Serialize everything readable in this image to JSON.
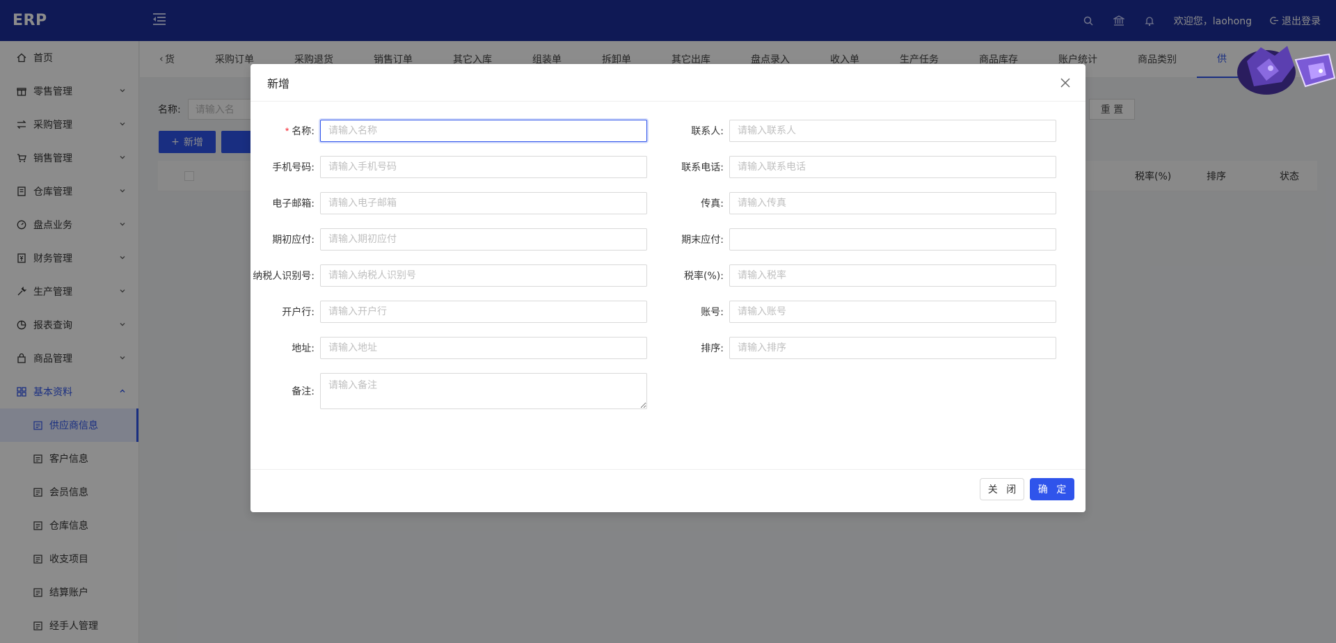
{
  "app": {
    "logo": "ERP"
  },
  "header": {
    "welcome": "欢迎您，laohong",
    "logout": "退出登录"
  },
  "sidebar": {
    "items": [
      {
        "label": "首页",
        "icon": "home-icon"
      },
      {
        "label": "零售管理",
        "icon": "gift-icon"
      },
      {
        "label": "采购管理",
        "icon": "swap-icon"
      },
      {
        "label": "销售管理",
        "icon": "cart-icon"
      },
      {
        "label": "仓库管理",
        "icon": "book-icon"
      },
      {
        "label": "盘点业务",
        "icon": "dashboard-icon"
      },
      {
        "label": "财务管理",
        "icon": "money-icon"
      },
      {
        "label": "生产管理",
        "icon": "tool-icon"
      },
      {
        "label": "报表查询",
        "icon": "chart-icon"
      },
      {
        "label": "商品管理",
        "icon": "shop-icon"
      },
      {
        "label": "基本资料",
        "icon": "grid-icon"
      }
    ],
    "subitems": [
      {
        "label": "供应商信息"
      },
      {
        "label": "客户信息"
      },
      {
        "label": "会员信息"
      },
      {
        "label": "仓库信息"
      },
      {
        "label": "收支项目"
      },
      {
        "label": "结算账户"
      },
      {
        "label": "经手人管理"
      }
    ]
  },
  "tabs": [
    "货",
    "采购订单",
    "采购退货",
    "销售订单",
    "其它入库",
    "组装单",
    "拆卸单",
    "其它出库",
    "盘点录入",
    "收入单",
    "生产任务",
    "商品库存",
    "账户统计",
    "商品类别",
    "供"
  ],
  "background": {
    "search_label": "名称:",
    "search_placeholder": "请输入名",
    "reset": "重 置",
    "add": "新增",
    "columns": [
      "税率(%)",
      "排序",
      "状态"
    ]
  },
  "modal": {
    "title": "新增",
    "left_fields": [
      {
        "label": "名称:",
        "placeholder": "请输入名称",
        "required": "*"
      },
      {
        "label": "手机号码:",
        "placeholder": "请输入手机号码"
      },
      {
        "label": "电子邮箱:",
        "placeholder": "请输入电子邮箱"
      },
      {
        "label": "期初应付:",
        "placeholder": "请输入期初应付"
      },
      {
        "label": "纳税人识别号:",
        "placeholder": "请输入纳税人识别号"
      },
      {
        "label": "开户行:",
        "placeholder": "请输入开户行"
      },
      {
        "label": "地址:",
        "placeholder": "请输入地址"
      },
      {
        "label": "备注:",
        "placeholder": "请输入备注"
      }
    ],
    "right_fields": [
      {
        "label": "联系人:",
        "placeholder": "请输入联系人"
      },
      {
        "label": "联系电话:",
        "placeholder": "请输入联系电话"
      },
      {
        "label": "传真:",
        "placeholder": "请输入传真"
      },
      {
        "label": "期末应付:",
        "placeholder": ""
      },
      {
        "label": "税率(%):",
        "placeholder": "请输入税率"
      },
      {
        "label": "账号:",
        "placeholder": "请输入账号"
      },
      {
        "label": "排序:",
        "placeholder": "请输入排序"
      }
    ],
    "close_label": "关 闭",
    "ok_label": "确 定"
  },
  "colors": {
    "header": "#1c2e9c",
    "primary": "#2f54eb",
    "required": "#f5222d"
  }
}
